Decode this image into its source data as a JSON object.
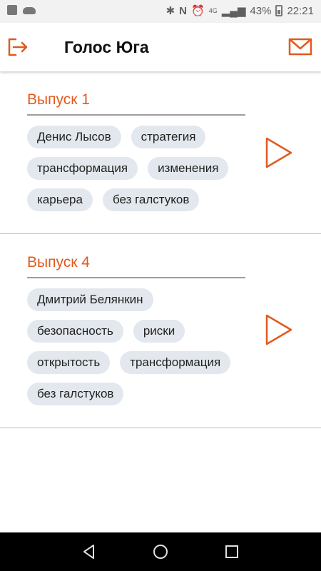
{
  "status_bar": {
    "battery_percent": "43%",
    "time": "22:21",
    "network": "4G"
  },
  "app_bar": {
    "title": "Голос Юга",
    "logout_icon": "logout-icon",
    "mail_icon": "mail-icon"
  },
  "episodes": [
    {
      "title": "Выпуск 1",
      "tags": [
        [
          "Денис Лысов",
          "стратегия"
        ],
        [
          "трансформация",
          "изменения"
        ],
        [
          "карьера",
          "без галстуков"
        ]
      ]
    },
    {
      "title": "Выпуск 4",
      "tags": [
        [
          "Дмитрий Белянкин"
        ],
        [
          "безопасность",
          "риски"
        ],
        [
          "открытость",
          "трансформация"
        ],
        [
          "без галстуков"
        ]
      ]
    }
  ],
  "colors": {
    "accent": "#e05a1f",
    "tag_bg": "#e3e8ee",
    "divider": "#bdbdbd"
  }
}
